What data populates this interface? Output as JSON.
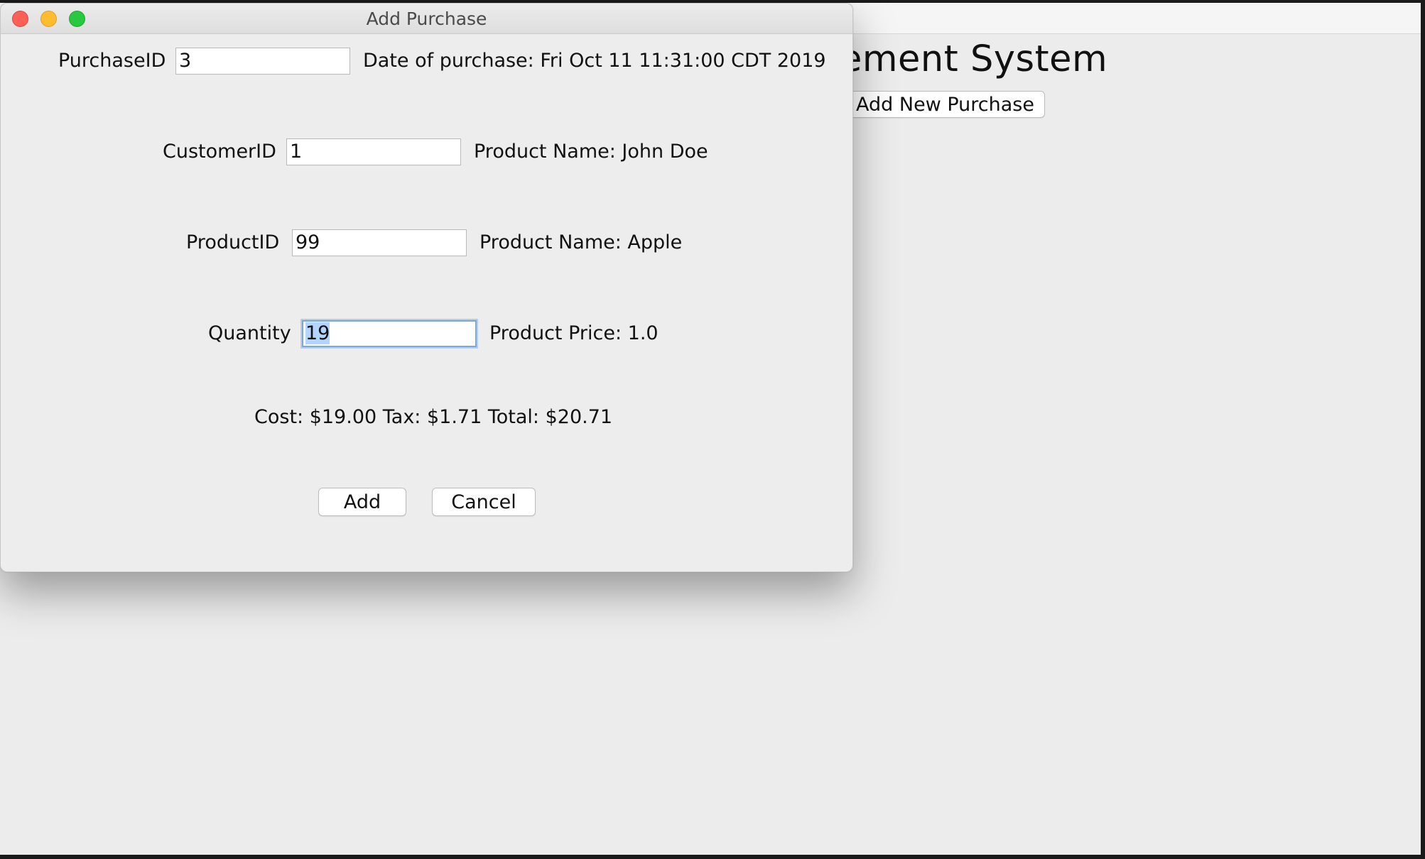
{
  "background_window": {
    "title_partial": "ement System",
    "add_new_purchase_label": "Add New Purchase"
  },
  "dialog": {
    "title": "Add Purchase",
    "purchase_id": {
      "label": "PurchaseID",
      "value": "3",
      "info": "Date of purchase: Fri Oct 11 11:31:00 CDT 2019"
    },
    "customer_id": {
      "label": "CustomerID",
      "value": "1",
      "info": "Product Name: John Doe"
    },
    "product_id": {
      "label": "ProductID",
      "value": "99",
      "info": "Product Name: Apple"
    },
    "quantity": {
      "label": "Quantity",
      "value": "19",
      "info": "Product Price: 1.0"
    },
    "summary": "Cost: $19.00 Tax: $1.71 Total: $20.71",
    "add_label": "Add",
    "cancel_label": "Cancel"
  },
  "colors": {
    "close": "#fe5f57",
    "minimize": "#febc2e",
    "maximize": "#28c840",
    "selection": "#b3d4fd",
    "focus_ring": "#7aa6e0"
  }
}
